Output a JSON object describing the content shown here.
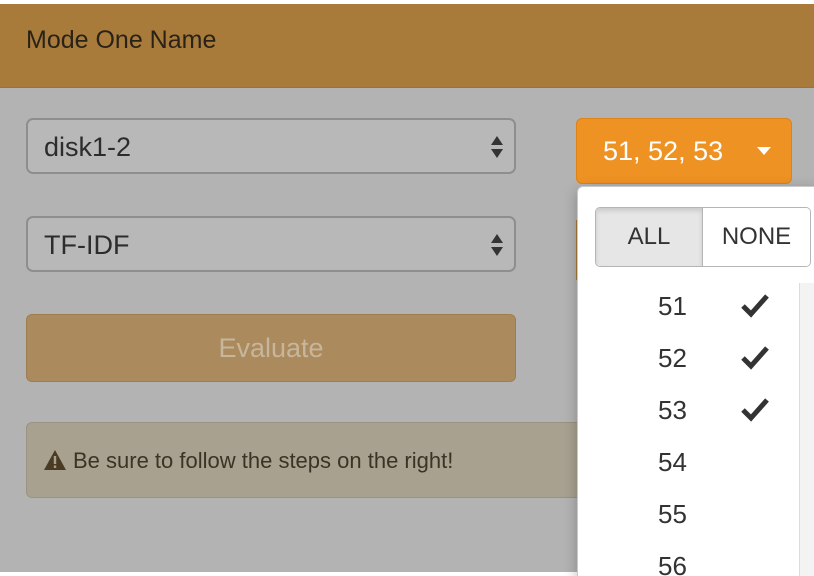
{
  "panel": {
    "title": "Mode One Name"
  },
  "form": {
    "dataset_select": {
      "value": "disk1-2"
    },
    "model_select": {
      "value": "TF-IDF"
    },
    "evaluate_button": {
      "label": "Evaluate"
    },
    "warning": {
      "text": "Be sure to follow the steps on the right!"
    }
  },
  "multiselect": {
    "button_label": "51, 52, 53",
    "all_label": "ALL",
    "none_label": "NONE",
    "options": [
      {
        "label": "51",
        "checked": true
      },
      {
        "label": "52",
        "checked": true
      },
      {
        "label": "53",
        "checked": true
      },
      {
        "label": "54",
        "checked": false
      },
      {
        "label": "55",
        "checked": false
      },
      {
        "label": "56",
        "checked": false
      }
    ]
  },
  "colors": {
    "header": "#a87b3a",
    "overlay": "#b3b3b3",
    "accent": "#ee9223"
  }
}
